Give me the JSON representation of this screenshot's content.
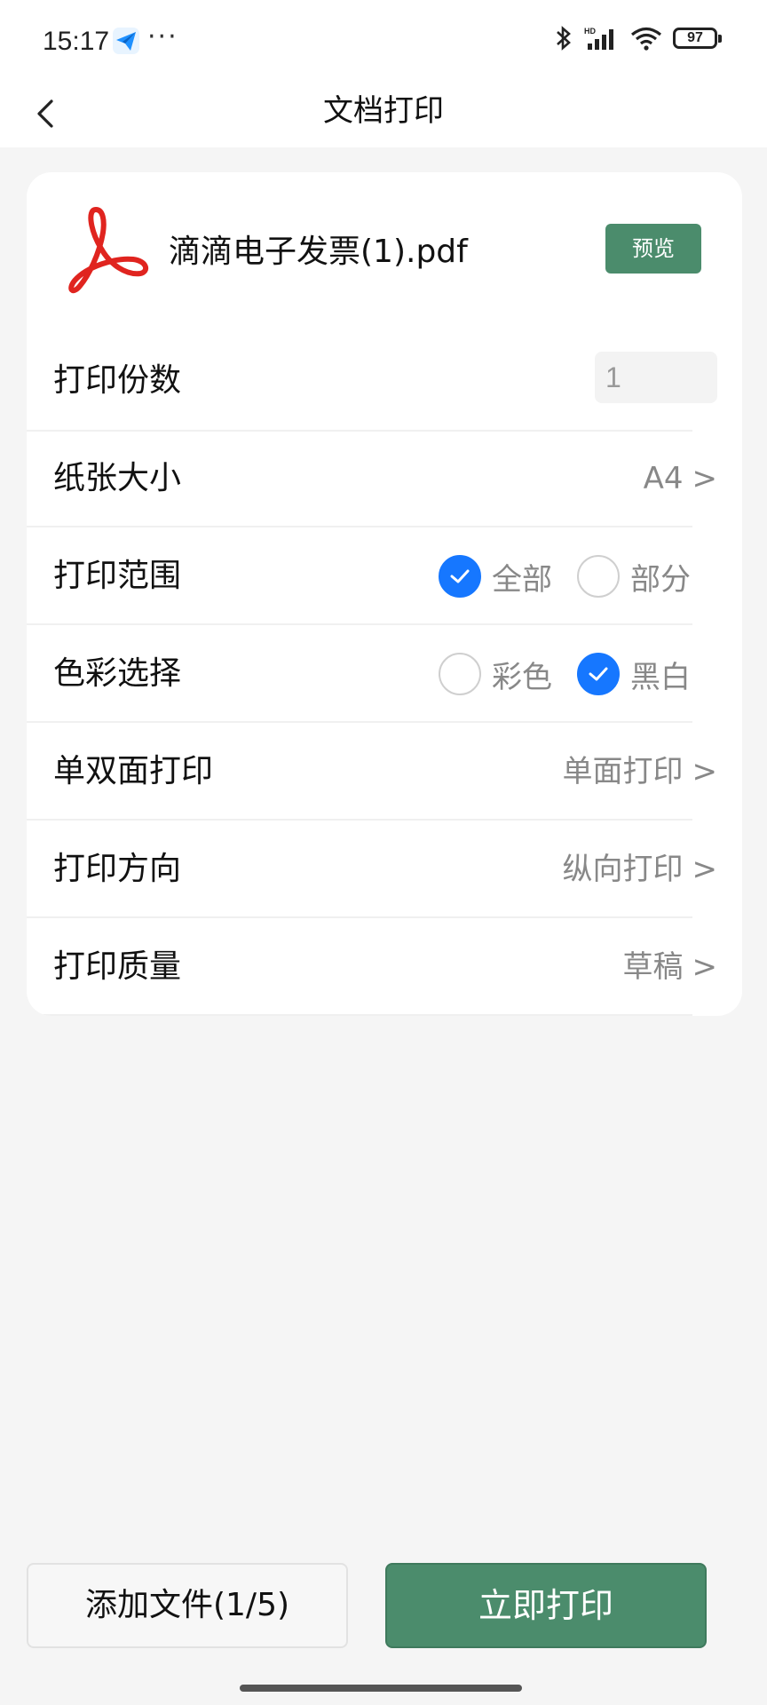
{
  "status": {
    "time": "15:17",
    "more": "···",
    "battery": "97"
  },
  "nav": {
    "title": "文档打印"
  },
  "file": {
    "name": "滴滴电子发票(1).pdf",
    "preview_label": "预览"
  },
  "rows": {
    "copies": {
      "label": "打印份数",
      "value": "1"
    },
    "paper_size": {
      "label": "纸张大小",
      "value": "A4",
      "chevron": ">"
    },
    "range": {
      "label": "打印范围",
      "options": [
        "全部",
        "部分"
      ],
      "selected": 0
    },
    "color": {
      "label": "色彩选择",
      "options": [
        "彩色",
        "黑白"
      ],
      "selected": 1
    },
    "duplex": {
      "label": "单双面打印",
      "value": "单面打印",
      "chevron": ">"
    },
    "orientation": {
      "label": "打印方向",
      "value": "纵向打印",
      "chevron": ">"
    },
    "quality": {
      "label": "打印质量",
      "value": "草稿",
      "chevron": ">"
    }
  },
  "bottom": {
    "add_file_label": "添加文件(1/5)",
    "print_label": "立即打印"
  },
  "colors": {
    "accent_green": "#4b8c6c",
    "check_blue": "#1677ff"
  }
}
